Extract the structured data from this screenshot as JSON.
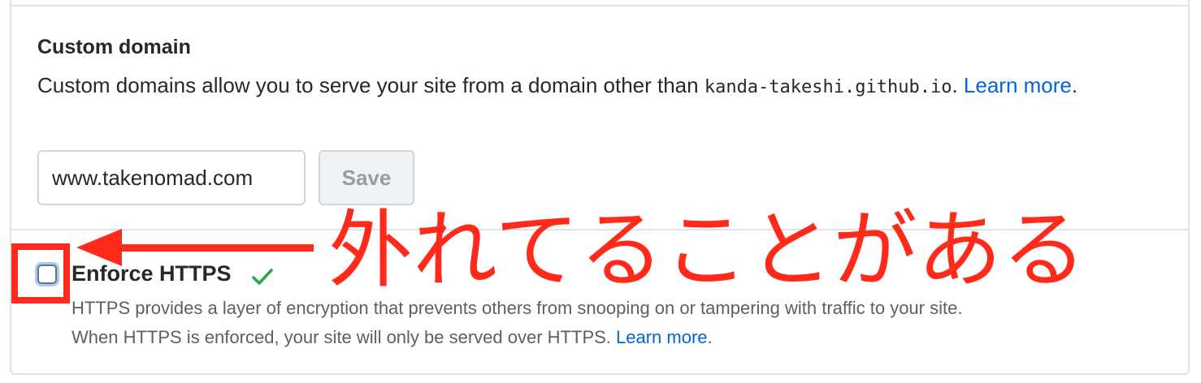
{
  "custom_domain": {
    "title": "Custom domain",
    "description_prefix": "Custom domains allow you to serve your site from a domain other than ",
    "default_domain": "kanda-takeshi.github.io",
    "description_suffix": ". ",
    "learn_more": "Learn more",
    "period": ".",
    "input_value": "www.takenomad.com",
    "save_label": "Save"
  },
  "enforce_https": {
    "title": "Enforce HTTPS",
    "checked": false,
    "check_icon": "check-icon",
    "description_line1": "HTTPS provides a layer of encryption that prevents others from snooping on or tampering with traffic to your site.",
    "description_line2": "When HTTPS is enforced, your site will only be served over HTTPS. ",
    "learn_more": "Learn more",
    "period": "."
  },
  "annotation": {
    "text": "外れてることがある",
    "color": "#ff2a1a"
  }
}
